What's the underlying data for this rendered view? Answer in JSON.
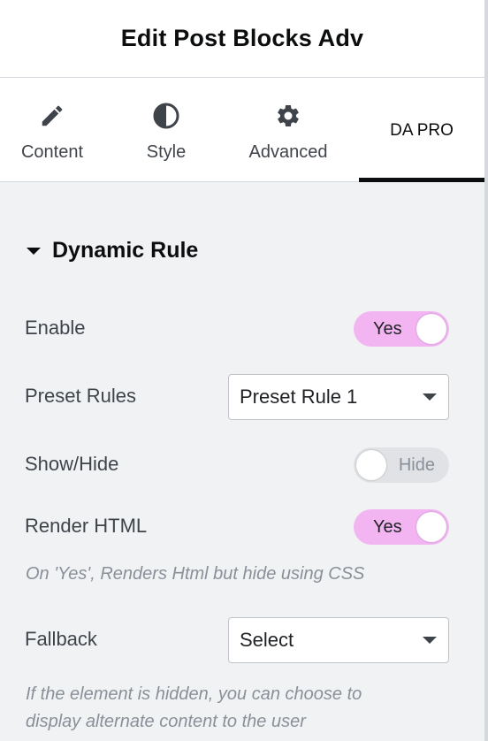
{
  "header": {
    "title": "Edit Post Blocks Adv"
  },
  "tabs": [
    {
      "label": "Content",
      "icon": "pencil-icon"
    },
    {
      "label": "Style",
      "icon": "half-circle-icon"
    },
    {
      "label": "Advanced",
      "icon": "gear-icon"
    },
    {
      "label": "DA PRO",
      "active": true
    }
  ],
  "section": {
    "title": "Dynamic Rule",
    "expanded": true
  },
  "fields": {
    "enable": {
      "label": "Enable",
      "value": "Yes",
      "on": true
    },
    "preset_rules": {
      "label": "Preset Rules",
      "value": "Preset Rule 1"
    },
    "show_hide": {
      "label": "Show/Hide",
      "value": "Hide",
      "on": false
    },
    "render_html": {
      "label": "Render HTML",
      "value": "Yes",
      "on": true,
      "help": "On 'Yes', Renders Html but hide using CSS"
    },
    "fallback": {
      "label": "Fallback",
      "value": "Select",
      "help_line1": "If the element is hidden, you can choose to",
      "help_line2": "display alternate content to the user"
    }
  },
  "colors": {
    "switch_on": "#f2b5f2",
    "switch_off": "#e0e2e5",
    "active_tab_underline": "#0c0d0e",
    "panel_bg": "#f1f2f3"
  }
}
